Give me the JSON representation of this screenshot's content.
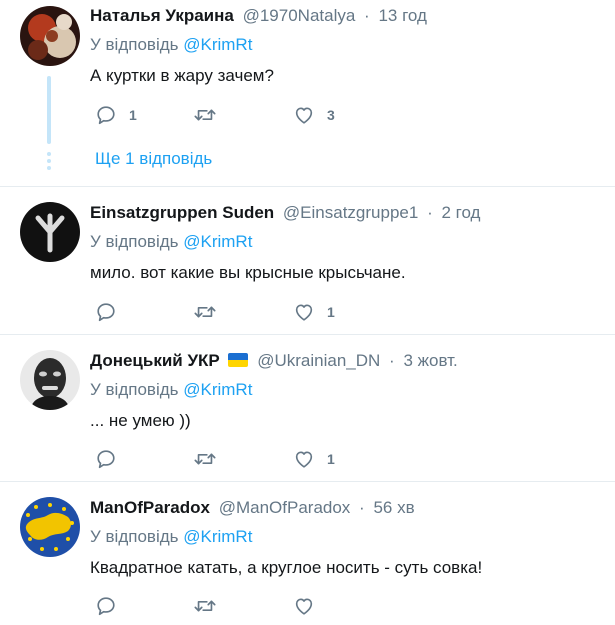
{
  "tweets": [
    {
      "fullname": "Наталья Украина",
      "username": "@1970Natalya",
      "time": "13 год",
      "reply_prefix": "У відповідь",
      "reply_mention": "@KrimRt",
      "text": "А куртки в жару зачем?",
      "reply_count": "1",
      "retweet_count": "",
      "like_count": "3",
      "more_replies": "Ще 1 відповідь"
    },
    {
      "fullname": "Einsatzgruppen Suden",
      "username": "@Einsatzgruppe1",
      "time": "2 год",
      "reply_prefix": "У відповідь",
      "reply_mention": "@KrimRt",
      "text": "мило. вот какие вы крысные крысьчане.",
      "reply_count": "",
      "retweet_count": "",
      "like_count": "1"
    },
    {
      "fullname": "Донецький УКР",
      "username": "@Ukrainian_DN",
      "time": "3 жовт.",
      "reply_prefix": "У відповідь",
      "reply_mention": "@KrimRt",
      "text": "... не умею ))",
      "reply_count": "",
      "retweet_count": "",
      "like_count": "1"
    },
    {
      "fullname": "ManOfParadox",
      "username": "@ManOfParadox",
      "time": "56 хв",
      "reply_prefix": "У відповідь",
      "reply_mention": "@KrimRt",
      "text": "Квадратное катать, а круглое носить - суть совка!",
      "reply_count": "",
      "retweet_count": "",
      "like_count": ""
    }
  ],
  "separator": "·",
  "colors": {
    "accent": "#1da1f2",
    "secondary_text": "#657786",
    "thread_line": "#c4e5f9",
    "divider": "#e6ecf0"
  },
  "icons": {
    "reply": "reply-icon",
    "retweet": "retweet-icon",
    "like": "heart-icon"
  }
}
